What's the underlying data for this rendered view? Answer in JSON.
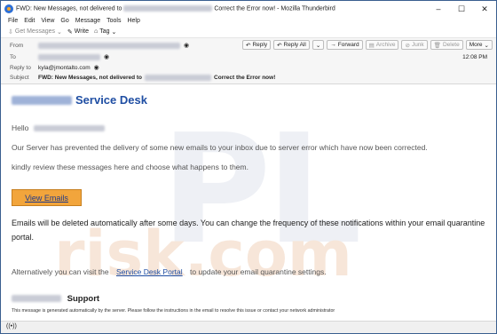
{
  "window": {
    "title_prefix": "FWD: New Messages, not delivered to",
    "title_suffix": "Correct the Error now! - Mozilla Thunderbird",
    "controls": [
      "–",
      "☐",
      "✕"
    ]
  },
  "menu": [
    "File",
    "Edit",
    "View",
    "Go",
    "Message",
    "Tools",
    "Help"
  ],
  "toolbar": {
    "get_messages": "Get Messages",
    "write": "Write",
    "tag": "Tag"
  },
  "header": {
    "from_label": "From",
    "to_label": "To",
    "reply_to_label": "Reply to",
    "reply_to_value": "kyla@jmontalto.com",
    "subject_label": "Subject",
    "subject_prefix": "FWD: New Messages, not delivered to",
    "subject_suffix": "Correct the Error now!",
    "time": "12:08 PM",
    "actions": {
      "reply": "Reply",
      "reply_all": "Reply All",
      "forward": "Forward",
      "archive": "Archive",
      "junk": "Junk",
      "delete": "Delete",
      "more": "More"
    }
  },
  "email": {
    "brand_title": "Service Desk",
    "greeting": "Hello",
    "para1": "Our Server has prevented the delivery of some new emails to your inbox due to server error which have now been corrected.",
    "para2": "kindly review these messages here and choose what happens to them.",
    "view_button": "View Emails",
    "warning": "Emails will be deleted automatically after some days. You can change the frequency of these notifications within your email quarantine portal.",
    "alt_prefix": "Alternatively you can visit the",
    "alt_link": "Service Desk Portal",
    "alt_suffix": "to update your email quarantine settings.",
    "support_title": "Support",
    "footer": "This message is generated automatically by the server. Please follow the instructions in the email to resolve this issue or contact your network administrator"
  },
  "status": {
    "icon": "((•))"
  },
  "watermark": {
    "big": "PL",
    "small": "risk.com"
  }
}
